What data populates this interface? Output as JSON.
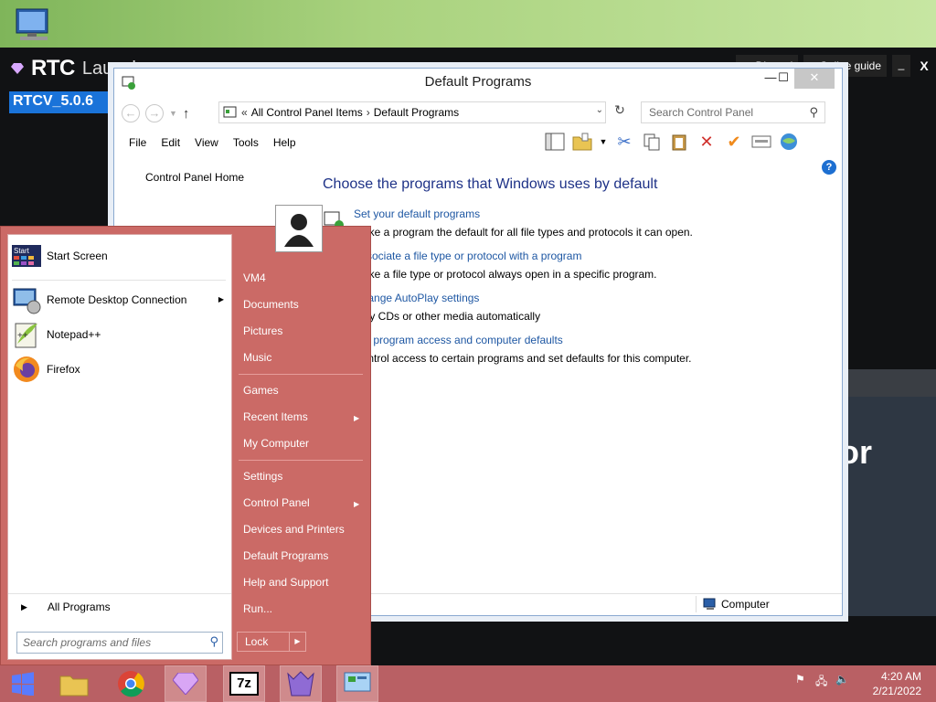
{
  "launcher": {
    "title": "RTC",
    "title_suffix": "Launcher",
    "version": "RTCV_5.0.6",
    "discord": "Discord",
    "online_guide": "Online guide",
    "minimize": "_",
    "close": "X",
    "partial_text": "or"
  },
  "window": {
    "title": "Default Programs",
    "address": {
      "overflow": "«",
      "crumbs": [
        "All Control Panel Items",
        "Default Programs"
      ]
    },
    "search_placeholder": "Search Control Panel",
    "menu": [
      "File",
      "Edit",
      "View",
      "Tools",
      "Help"
    ],
    "left_link": "Control Panel Home",
    "heading": "Choose the programs that Windows uses by default",
    "options": [
      {
        "link": "Set your default programs",
        "desc": "Make a program the default for all file types and protocols it can open."
      },
      {
        "link": "Associate a file type or protocol with a program",
        "desc": "Make a file type or protocol always open in a specific program."
      },
      {
        "link": "Change AutoPlay settings",
        "desc": "Play CDs or other media automatically"
      },
      {
        "link": "Set program access and computer defaults",
        "desc": "Control access to certain programs and set defaults for this computer."
      }
    ],
    "status": "Computer"
  },
  "start_menu": {
    "pinned": [
      {
        "label": "Start Screen",
        "icon": "start-screen-icon"
      },
      {
        "label": "Remote Desktop Connection",
        "icon": "remote-desktop-icon",
        "submenu": true
      },
      {
        "label": "Notepad++",
        "icon": "notepad-plus-icon"
      },
      {
        "label": "Firefox",
        "icon": "firefox-icon"
      }
    ],
    "start_screen_badge": "Start",
    "all_programs": "All Programs",
    "search_placeholder": "Search programs and files",
    "right": [
      {
        "label": "VM4"
      },
      {
        "label": "Documents"
      },
      {
        "label": "Pictures"
      },
      {
        "label": "Music"
      },
      {
        "label": "Games"
      },
      {
        "label": "Recent Items",
        "submenu": true
      },
      {
        "label": "My Computer"
      },
      {
        "label": "Settings"
      },
      {
        "label": "Control Panel",
        "submenu": true
      },
      {
        "label": "Devices and Printers"
      },
      {
        "label": "Default Programs"
      },
      {
        "label": "Help and Support"
      },
      {
        "label": "Run..."
      }
    ],
    "lock": "Lock"
  },
  "taskbar": {
    "apps": [
      "start-button",
      "file-explorer-icon",
      "chrome-icon",
      "rtc-launcher-icon",
      "7zip-icon",
      "game-icon",
      "control-panel-icon"
    ],
    "seven_zip": "7z",
    "time": "4:20 AM",
    "date": "2/21/2022"
  },
  "colors": {
    "start_menu": "#cb6a66",
    "taskbar": "#b96064",
    "link": "#1e57a3",
    "heading": "#1e3287",
    "version_badge": "#1a73d9"
  }
}
